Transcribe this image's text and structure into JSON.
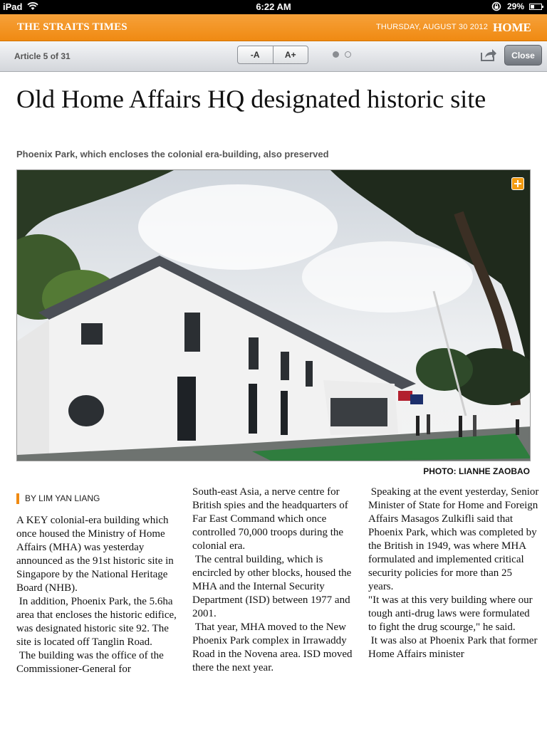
{
  "status_bar": {
    "device": "iPad",
    "time": "6:22 AM",
    "battery": "29%",
    "battery_level": 0.29
  },
  "masthead": {
    "logo": "THE STRAITS TIMES",
    "date": "THURSDAY, AUGUST 30 2012",
    "section": "HOME"
  },
  "toolbar": {
    "article_count": "Article 5 of 31",
    "font_decrease": "-A",
    "font_increase": "A+",
    "page_dots": 2,
    "current_page": 1,
    "close_label": "Close"
  },
  "article": {
    "headline": "Old Home Affairs HQ designated historic site",
    "subheadline": "Phoenix Park, which encloses the colonial era-building, also preserved",
    "photo_credit": "PHOTO: LIANHE ZAOBAO",
    "byline": "BY LIM YAN LIANG",
    "columns": [
      [
        "A KEY colonial-era building which once housed the Ministry of Home Affairs (MHA) was yesterday announced as the 91st historic site in Singapore by the National Heritage Board (NHB).",
        " In addition, Phoenix Park, the 5.6ha area that encloses the historic edifice, was designated historic site 92. The site is located off Tanglin Road.",
        " The building was the office of the Commissioner-General for"
      ],
      [
        "South-east Asia, a nerve centre for British spies and the headquarters of Far East Command which once controlled 70,000 troops during the colonial era.",
        " The central building, which is encircled by other blocks, housed the MHA and the Internal Security Department (ISD) between 1977 and 2001.",
        " That year, MHA moved to the New Phoenix Park complex in Irrawaddy Road in the Novena area. ISD moved there the next year."
      ],
      [
        " Speaking at the event yesterday, Senior Minister of State for Home and Foreign Affairs Masagos Zulkifli said that Phoenix Park, which was completed by the British in 1949, was where MHA formulated and implemented critical security policies for more than 25 years.",
        "\"It was at this very building where our tough anti-drug laws were formulated to fight the drug scourge,\" he said.",
        " It was also at Phoenix Park that former Home Affairs minister"
      ]
    ]
  },
  "colors": {
    "masthead_orange": "#f08a12",
    "toolbar_gray": "#d3d6db"
  }
}
